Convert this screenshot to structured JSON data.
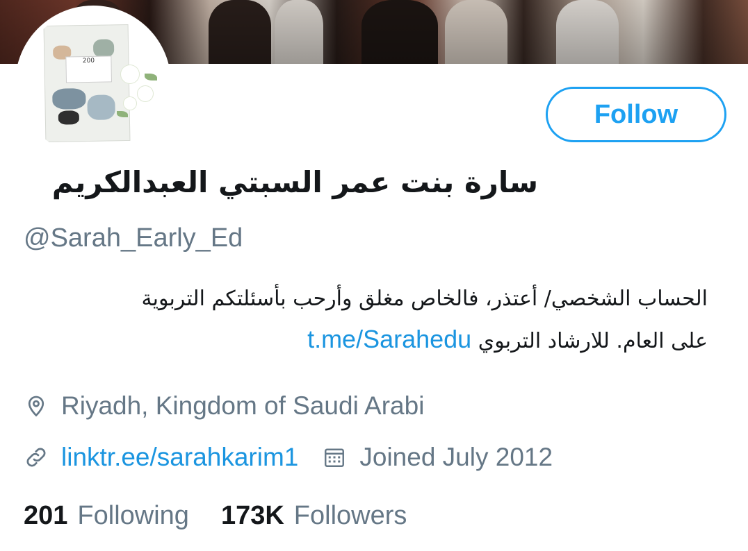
{
  "profile": {
    "display_name": "سارة بنت عمر السبتي العبدالكريم",
    "handle": "@Sarah_Early_Ed",
    "follow_label": "Follow",
    "bio_line1": "الحساب الشخصي/ أعتذر، فالخاص مغلق وأرحب بأسئلتكم التربوية",
    "bio_line2_text": "على العام. للارشاد التربوي",
    "bio_link": "t.me/Sarahedu",
    "location": "Riyadh, Kingdom of Saudi Arabi",
    "website": "linktr.ee/sarahkarim1",
    "joined": "Joined July 2012"
  },
  "stats": {
    "following_count": "201",
    "following_label": "Following",
    "followers_count": "173K",
    "followers_label": "Followers"
  },
  "avatar": {
    "book_title": "200"
  },
  "colors": {
    "accent": "#1da1f2",
    "link": "#1b95e0",
    "secondary_text": "#657786",
    "primary_text": "#14171a"
  },
  "icons": [
    "location-pin-icon",
    "link-icon",
    "calendar-icon"
  ]
}
